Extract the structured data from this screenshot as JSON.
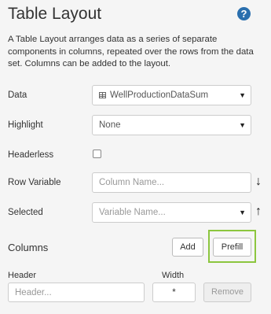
{
  "panel": {
    "title": "Table Layout",
    "description": "A Table Layout arranges data as a series of separate components in columns, repeated over the rows from the data set. Columns can be added to the layout."
  },
  "fields": {
    "data": {
      "label": "Data",
      "value": "WellProductionDataSum"
    },
    "highlight": {
      "label": "Highlight",
      "value": "None"
    },
    "headerless": {
      "label": "Headerless",
      "checked": false
    },
    "row_variable": {
      "label": "Row Variable",
      "placeholder": "Column Name..."
    },
    "selected": {
      "label": "Selected",
      "placeholder": "Variable Name..."
    }
  },
  "columns": {
    "title": "Columns",
    "add_label": "Add",
    "prefill_label": "Prefill",
    "header_label": "Header",
    "width_label": "Width",
    "header_placeholder": "Header...",
    "width_value": "*",
    "remove_label": "Remove"
  },
  "colors": {
    "accent": "#2a6fae",
    "highlight": "#8cc63f"
  }
}
